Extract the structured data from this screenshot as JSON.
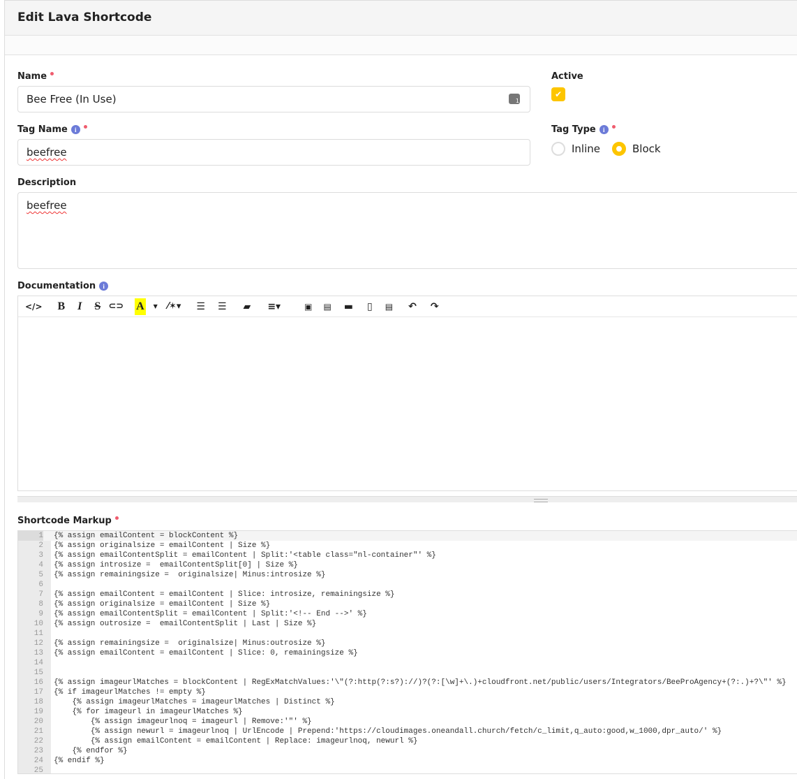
{
  "header": {
    "title": "Edit Lava Shortcode"
  },
  "form": {
    "name": {
      "label": "Name",
      "value": "Bee Free (In Use)"
    },
    "active": {
      "label": "Active",
      "checked": true
    },
    "tag_name": {
      "label": "Tag Name",
      "value": "beefree"
    },
    "tag_type": {
      "label": "Tag Type",
      "options": [
        "Inline",
        "Block"
      ],
      "selected": "Block"
    },
    "description": {
      "label": "Description",
      "value": "beefree"
    },
    "documentation": {
      "label": "Documentation",
      "toolbar": [
        "code-view",
        "bold",
        "italic",
        "strikethrough",
        "link",
        "font-color",
        "dropdown",
        "style-wand",
        "ordered-list",
        "unordered-list",
        "clear-format",
        "align",
        "image",
        "document",
        "folder",
        "paste",
        "word-paste",
        "undo",
        "redo"
      ]
    },
    "markup": {
      "label": "Shortcode Markup",
      "lines": [
        "{% assign emailContent = blockContent %}",
        "{% assign originalsize = emailContent | Size %}",
        "{% assign emailContentSplit = emailContent | Split:'<table class=\"nl-container\"' %}",
        "{% assign introsize =  emailContentSplit[0] | Size %}",
        "{% assign remainingsize =  originalsize| Minus:introsize %}",
        "",
        "{% assign emailContent = emailContent | Slice: introsize, remainingsize %}",
        "{% assign originalsize = emailContent | Size %}",
        "{% assign emailContentSplit = emailContent | Split:'<!-- End -->' %}",
        "{% assign outrosize =  emailContentSplit | Last | Size %}",
        "",
        "{% assign remainingsize =  originalsize| Minus:outrosize %}",
        "{% assign emailContent = emailContent | Slice: 0, remainingsize %}",
        "",
        "",
        "{% assign imageurlMatches = blockContent | RegExMatchValues:'\\\"(?:http(?:s?)://)?(?:[\\w]+\\.)+cloudfront.net/public/users/Integrators/BeeProAgency+(?:.)+?\\\"' %}",
        "{% if imageurlMatches != empty %}",
        "    {% assign imageurlMatches = imageurlMatches | Distinct %}",
        "    {% for imageurl in imageurlMatches %}",
        "        {% assign imageurlnoq = imageurl | Remove:'\"' %}",
        "        {% assign newurl = imageurlnoq | UrlEncode | Prepend:'https://cloudimages.oneandall.church/fetch/c_limit,q_auto:good,w_1000,dpr_auto/' %}",
        "        {% assign emailContent = emailContent | Replace: imageurlnoq, newurl %}",
        "    {% endfor %}",
        "{% endif %}",
        ""
      ]
    }
  },
  "colors": {
    "accent": "#fdc500",
    "info": "#6c7bd8",
    "required": "#ef5c6e"
  }
}
